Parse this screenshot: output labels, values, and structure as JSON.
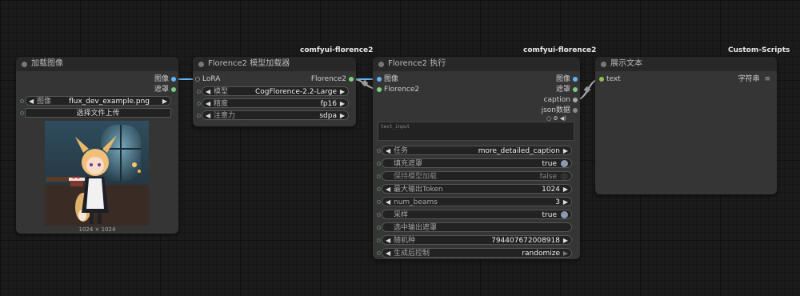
{
  "tags": {
    "florence_loader": "comfyui-florence2",
    "florence_run": "comfyui-florence2",
    "show_text": "Custom-Scripts"
  },
  "load_image": {
    "title": "加载图像",
    "out_image": "图像",
    "out_mask": "遮罩",
    "image_label": "图像",
    "image_value": "flux_dev_example.png",
    "upload_label": "选择文件上传",
    "dimensions": "1024 × 1024"
  },
  "loader": {
    "title": "Florence2 模型加载器",
    "in_lora": "LoRA",
    "out_florence2": "Florence2",
    "widgets": [
      {
        "label": "模型",
        "value": "CogFlorence-2.2-Large"
      },
      {
        "label": "精度",
        "value": "fp16"
      },
      {
        "label": "注意力",
        "value": "sdpa"
      }
    ]
  },
  "run": {
    "title": "Florence2 执行",
    "in_image": "图像",
    "in_florence2": "Florence2",
    "out_image": "图像",
    "out_mask": "遮罩",
    "out_caption": "caption",
    "out_json": "json数据",
    "text_input_placeholder": "text_input",
    "widgets": [
      {
        "label": "任务",
        "value": "more_detailed_caption",
        "kind": "combo"
      },
      {
        "label": "填充遮罩",
        "value": "true",
        "kind": "toggle_on"
      },
      {
        "label": "保持模型加载",
        "value": "false",
        "kind": "toggle_off"
      },
      {
        "label": "最大输出Token",
        "value": "1024",
        "kind": "number"
      },
      {
        "label": "num_beams",
        "value": "3",
        "kind": "number"
      },
      {
        "label": "采样",
        "value": "true",
        "kind": "toggle_on"
      },
      {
        "label": "选中输出遮罩",
        "value": "",
        "kind": "text"
      },
      {
        "label": "随机种",
        "value": "794407672008918",
        "kind": "number"
      },
      {
        "label": "生成后控制",
        "value": "randomize",
        "kind": "combo"
      }
    ]
  },
  "show_text": {
    "title": "展示文本",
    "in_text": "text",
    "out_string": "字符串",
    "list_icon": "≡"
  },
  "colors": {
    "image_port": "#64b5f6",
    "mask_port": "#81c784",
    "florence_port": "#7ad47a",
    "string_port": "#8bc34a"
  }
}
